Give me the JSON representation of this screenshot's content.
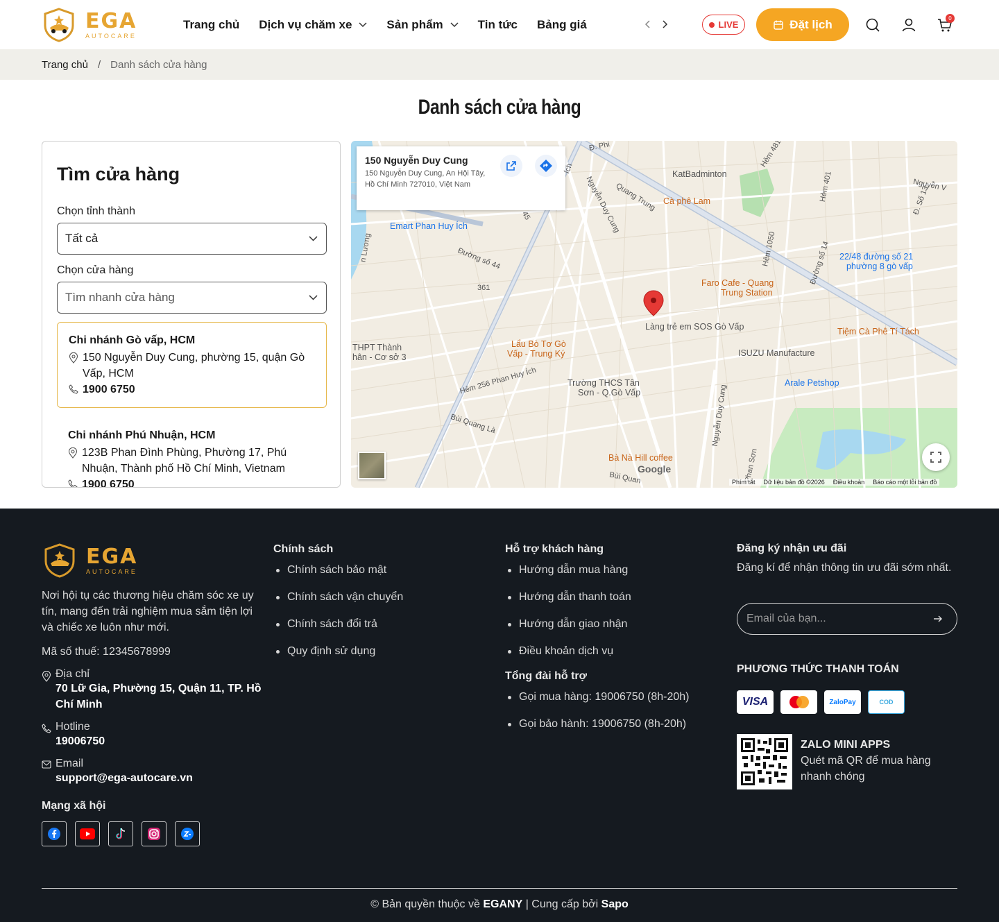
{
  "header": {
    "brand": "EGA",
    "brand_sub": "AUTOCARE",
    "nav": [
      {
        "label": "Trang chủ",
        "has_dropdown": false
      },
      {
        "label": "Dịch vụ chăm xe",
        "has_dropdown": true
      },
      {
        "label": "Sản phẩm",
        "has_dropdown": true
      },
      {
        "label": "Tin tức",
        "has_dropdown": false
      },
      {
        "label": "Bảng giá",
        "has_dropdown": false
      }
    ],
    "live_label": "LIVE",
    "book_label": "Đặt lịch",
    "cart_count": "0",
    "icons": [
      "chevron-left-icon",
      "chevron-right-icon",
      "calendar-icon",
      "search-icon",
      "user-icon",
      "cart-icon"
    ]
  },
  "breadcrumb": {
    "home": "Trang chủ",
    "separator": "/",
    "current": "Danh sách cửa hàng"
  },
  "page_title": "Danh sách cửa hàng",
  "store_panel": {
    "title": "Tìm cửa hàng",
    "province_label": "Chọn tỉnh thành",
    "province_value": "Tất cả",
    "store_label": "Chọn cửa hàng",
    "store_placeholder": "Tìm nhanh cửa hàng",
    "stores": [
      {
        "name": "Chi nhánh Gò vấp, HCM",
        "address": "150 Nguyễn Duy Cung, phường 15, quận Gò Vấp, HCM",
        "phone": "1900 6750",
        "active": true
      },
      {
        "name": "Chi nhánh Phú Nhuận, HCM",
        "address": "123B Phan Đình Phùng, Phường 17, Phú Nhuận, Thành phố Hồ Chí Minh, Vietnam",
        "phone": "1900 6750",
        "active": false
      }
    ]
  },
  "map": {
    "card_title": "150 Nguyễn Duy Cung",
    "card_address": "150 Nguyễn Duy Cung, An Hội Tây, Hồ Chí Minh 727010, Việt Nam",
    "pois": {
      "katbadminton": "KatBadminton",
      "caphe_lam": "Cà phê Lam",
      "emart": "Emart Phan Huy Ích",
      "faro_1": "Faro Cafe - Quang",
      "faro_2": "Trung Station",
      "duong21_1": "22/48 đường số 21",
      "duong21_2": "phường 8 gò vấp",
      "sos": "Làng trẻ em SOS Gò Vấp",
      "tiemcaphe": "Tiệm Cà Phê Tí Tách",
      "thpt_1": "THPT Thành",
      "thpt_2": "hân - Cơ sở 3",
      "laubo_1": "Lẩu Bò Tơ Gò",
      "laubo_2": "Vấp - Trung Ký",
      "isuzu": "ISUZU Manufacture",
      "arale": "Arale Petshop",
      "thcs_1": "Trường THCS Tân",
      "thcs_2": "Sơn - Q.Gò Vấp",
      "banahill": "Bà Nà Hill coffee"
    },
    "roads": {
      "quang_trung": "Quang Trung",
      "nguyen_duy_cung": "Nguyễn Duy Cung",
      "nguyen_duy_cung_2": "Nguyễn Duy Cung",
      "duong_so_44": "Đường số 44",
      "r361": "361",
      "hem_256": "Hẻm 256 Phan Huy Ích",
      "bui_quang_la": "Bùi Quang Là",
      "bui_quang_la_2": "Bùi Quan",
      "duong_so_14": "Đường số 14",
      "hem_1050": "Hẻm 1050",
      "hem_401": "Hẻm 401",
      "hem_481": "Hẻm 481",
      "nguyen_v": "Nguyễn V",
      "d_phan": "Đ. Phi",
      "so_13": "Đ. Số 13",
      "phan_son": "Phan Sơn",
      "r45": "45",
      "ich": "ích",
      "luong": "n Lương"
    },
    "google_label": "Google",
    "footer_links": [
      "Phím tắt",
      "Dữ liệu bản đồ ©2026",
      "Điều khoản",
      "Báo cáo một lỗi bản đồ"
    ]
  },
  "footer": {
    "brand": "EGA",
    "brand_sub": "AUTOCARE",
    "about": "Nơi hội tụ các thương hiệu chăm sóc xe uy tín, mang đến trải nghiệm mua sắm tiện lợi và chiếc xe luôn như mới.",
    "tax": "Mã số thuế: 12345678999",
    "address_label": "Địa chỉ",
    "address_value": "70 Lữ Gia, Phường 15, Quận 11, TP. Hồ Chí Minh",
    "hotline_label": "Hotline",
    "hotline_value": "19006750",
    "email_label": "Email",
    "email_value": "support@ega-autocare.vn",
    "social_title": "Mạng xã hội",
    "social_icons": [
      "facebook-icon",
      "youtube-icon",
      "tiktok-icon",
      "instagram-icon",
      "zalo-icon"
    ],
    "policy_title": "Chính sách",
    "policies": [
      "Chính sách bảo mật",
      "Chính sách vận chuyển",
      "Chính sách đổi trả",
      "Quy định sử dụng"
    ],
    "support_title": "Hỗ trợ khách hàng",
    "supports": [
      "Hướng dẫn mua hàng",
      "Hướng dẫn thanh toán",
      "Hướng dẫn giao nhận",
      "Điều khoản dịch vụ"
    ],
    "hotline_title": "Tổng đài hỗ trợ",
    "hotlines": [
      "Gọi mua hàng: 19006750 (8h-20h)",
      "Gọi bảo hành: 19006750 (8h-20h)"
    ],
    "subscribe_title": "Đăng ký nhận ưu đãi",
    "subscribe_text": "Đăng kí để nhận thông tin ưu đãi sớm nhất.",
    "email_placeholder": "Email của bạn...",
    "payment_title": "PHƯƠNG THỨC THANH TOÁN",
    "payments": [
      "VISA",
      "mastercard",
      "ZaloPay",
      "COD"
    ],
    "zalo_title": "ZALO MINI APPS",
    "zalo_text": "Quét mã QR để mua hàng nhanh chóng",
    "copyright_prefix": "© Bản quyền thuộc về",
    "copyright_brand": "EGANY",
    "copyright_mid": "| Cung cấp bởi",
    "copyright_provider": "Sapo"
  },
  "colors": {
    "accent": "#f5a623",
    "footer_bg": "#151a20",
    "live_red": "#e53935",
    "active_border": "#e6b84b"
  }
}
